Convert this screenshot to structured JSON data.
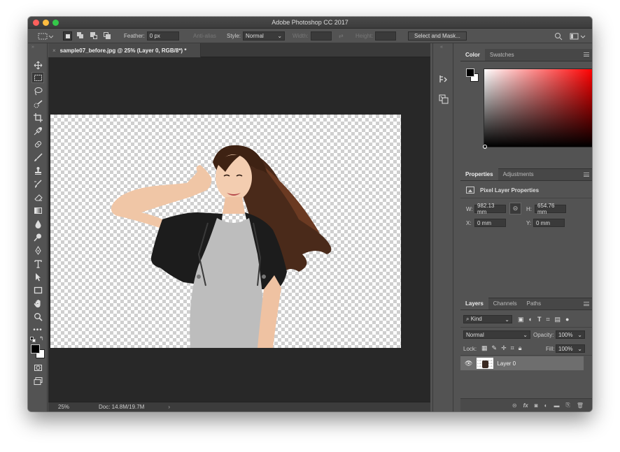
{
  "window": {
    "title": "Adobe Photoshop CC 2017"
  },
  "options_bar": {
    "feather_label": "Feather:",
    "feather_value": "0 px",
    "antialias_label": "Anti-alias",
    "style_label": "Style:",
    "style_value": "Normal",
    "width_label": "Width:",
    "height_label": "Height:",
    "select_mask_label": "Select and Mask..."
  },
  "tools": [
    "move-tool",
    "marquee-tool",
    "lasso-tool",
    "quick-select-tool",
    "crop-tool",
    "eyedropper-tool",
    "healing-brush-tool",
    "brush-tool",
    "clone-stamp-tool",
    "history-brush-tool",
    "eraser-tool",
    "gradient-tool",
    "blur-tool",
    "dodge-tool",
    "pen-tool",
    "type-tool",
    "path-selection-tool",
    "rectangle-tool",
    "hand-tool",
    "zoom-tool",
    "more-tools"
  ],
  "document": {
    "tab_title": "sample07_before.jpg @ 25% (Layer 0, RGB/8*) *",
    "zoom": "25%",
    "doc_info": "Doc: 14.8M/19.7M"
  },
  "color_panel": {
    "tabs": [
      "Color",
      "Swatches"
    ],
    "active": "Color"
  },
  "properties_panel": {
    "tabs": [
      "Properties",
      "Adjustments"
    ],
    "heading": "Pixel Layer Properties",
    "w_label": "W:",
    "w_value": "982.13 mm",
    "h_label": "H:",
    "h_value": "654.76 mm",
    "x_label": "X:",
    "x_value": "0 mm",
    "y_label": "Y:",
    "y_value": "0 mm"
  },
  "layers_panel": {
    "tabs": [
      "Layers",
      "Channels",
      "Paths"
    ],
    "filter_kind": "Kind",
    "blend_mode": "Normal",
    "opacity_label": "Opacity:",
    "opacity_value": "100%",
    "lock_label": "Lock:",
    "fill_label": "Fill:",
    "fill_value": "100%",
    "layers": [
      {
        "name": "Layer 0",
        "visible": true,
        "selected": true
      }
    ]
  },
  "colors": {
    "ui_bg": "#535353",
    "doc_bg": "#282828",
    "accent": "#6e6e6e"
  }
}
